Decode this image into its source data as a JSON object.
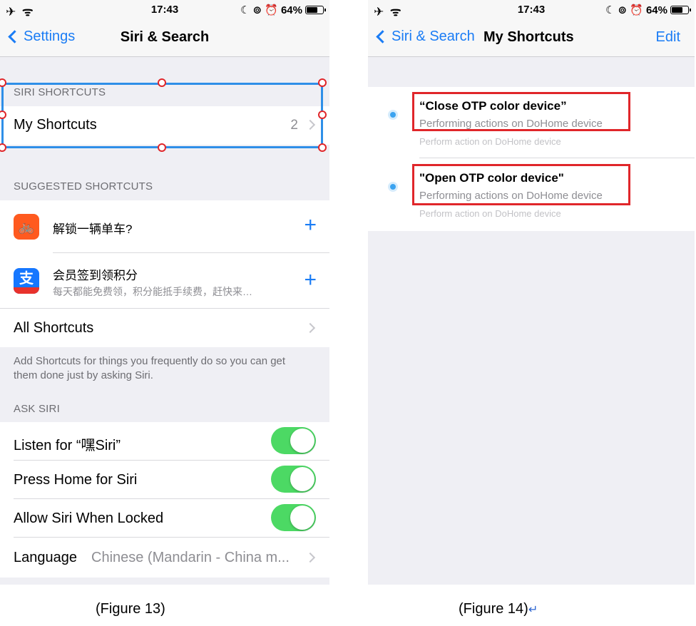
{
  "status": {
    "time": "17:43",
    "battery": "64%",
    "left_icons": "✈ ᯤ",
    "right_icons": "☾ ⊚ ⏰"
  },
  "left": {
    "nav": {
      "back": "Settings",
      "title": "Siri & Search"
    },
    "siri_shortcuts": {
      "header": "SIRI SHORTCUTS",
      "my_shortcuts": "My Shortcuts",
      "count": "2"
    },
    "suggested": {
      "header": "SUGGESTED SHORTCUTS",
      "items": [
        {
          "title": "解锁一辆单车?",
          "subtitle": "",
          "icon": "bike-icon"
        },
        {
          "title": "会员签到领积分",
          "subtitle": "每天都能免费领，积分能抵手续费，赶快来…",
          "icon": "alipay-icon"
        }
      ],
      "all": "All Shortcuts",
      "note": "Add Shortcuts for things you frequently do so you can get them done just by asking Siri."
    },
    "ask_siri": {
      "header": "ASK SIRI",
      "toggles": [
        {
          "label": "Listen for “嘿Siri”",
          "on": true
        },
        {
          "label": "Press Home for Siri",
          "on": true
        },
        {
          "label": "Allow Siri When Locked",
          "on": true
        }
      ],
      "language_label": "Language",
      "language_value": "Chinese (Mandarin - China m..."
    },
    "caption": "(Figure 13)"
  },
  "right": {
    "nav": {
      "back": "Siri & Search",
      "title": "My Shortcuts",
      "edit": "Edit"
    },
    "shortcuts": [
      {
        "title": "“Close OTP color device”",
        "subtitle": "Performing actions on DoHome device",
        "detail": "Perform action on DoHome device"
      },
      {
        "title": "\"Open OTP color device\"",
        "subtitle": "Performing actions on DoHome device",
        "detail": "Perform action on DoHome device"
      }
    ],
    "caption": "(Figure 14)",
    "return_mark": "↵"
  },
  "colors": {
    "accent": "#1a7cf5",
    "toggle_on": "#4cd964",
    "annotation_red": "#e0262a",
    "annotation_blue": "#2f8fe8"
  }
}
